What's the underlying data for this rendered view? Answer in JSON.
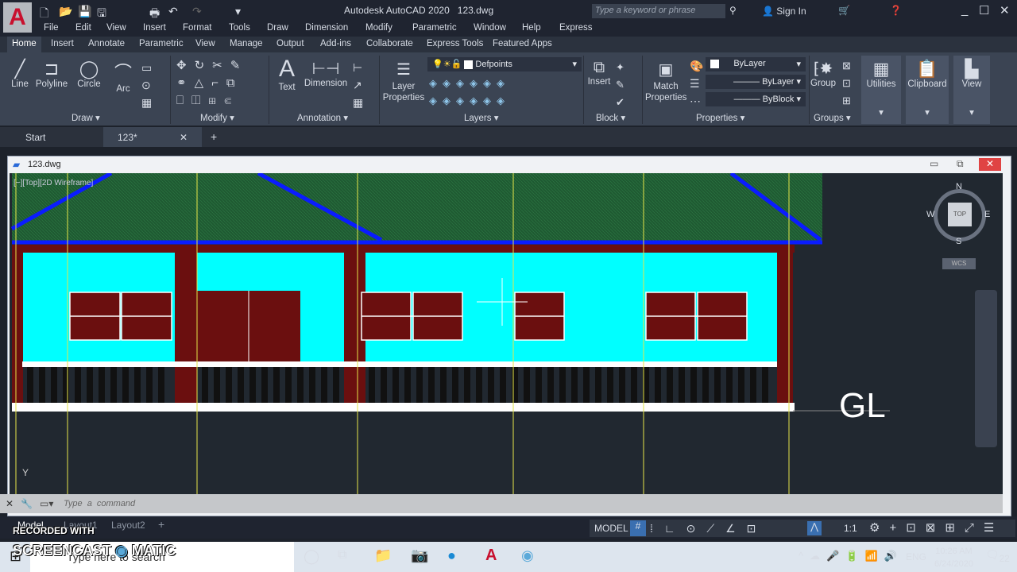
{
  "title": {
    "app": "Autodesk AutoCAD 2020",
    "file": "123.dwg",
    "search_placeholder": "Type a keyword or phrase",
    "sign_in": "Sign In",
    "logo": "A"
  },
  "menu": [
    "File",
    "Edit",
    "View",
    "Insert",
    "Format",
    "Tools",
    "Draw",
    "Dimension",
    "Modify",
    "Parametric",
    "Window",
    "Help",
    "Express"
  ],
  "ribbon_tabs": [
    "Home",
    "Insert",
    "Annotate",
    "Parametric",
    "View",
    "Manage",
    "Output",
    "Add-ins",
    "Collaborate",
    "Express Tools",
    "Featured Apps"
  ],
  "ribbon": {
    "draw": {
      "line": "Line",
      "polyline": "Polyline",
      "circle": "Circle",
      "arc": "Arc",
      "label": "Draw"
    },
    "modify": {
      "label": "Modify"
    },
    "annotation": {
      "text": "Text",
      "dimension": "Dimension",
      "label": "Annotation"
    },
    "layers": {
      "layer_properties_1": "Layer",
      "layer_properties_2": "Properties",
      "current_layer": "Defpoints",
      "label": "Layers"
    },
    "block": {
      "insert": "Insert",
      "label": "Block"
    },
    "properties": {
      "match_1": "Match",
      "match_2": "Properties",
      "color": "ByLayer",
      "linetype": "ByLayer",
      "lineweight": "ByBlock",
      "label": "Properties"
    },
    "groups": {
      "group": "Group",
      "label": "Groups"
    },
    "utilities": "Utilities",
    "clipboard": "Clipboard",
    "view": "View"
  },
  "file_tabs": {
    "start": "Start",
    "doc": "123*"
  },
  "drawing_window": {
    "title": "123.dwg",
    "viewport_label": "[−][Top][2D Wireframe]",
    "annotation_text": "GL",
    "ucs_y": "Y"
  },
  "viewcube": {
    "n": "N",
    "s": "S",
    "e": "E",
    "w": "W",
    "top": "TOP",
    "wcs": "WCS"
  },
  "command": {
    "placeholder": "Type a command"
  },
  "layout_tabs": [
    "Model",
    "Layout1",
    "Layout2",
    "+"
  ],
  "status": {
    "model": "MODEL",
    "scale": "1:1"
  },
  "taskbar": {
    "search_placeholder": "Type here to search",
    "lang": "ENG",
    "time": "10:26 AM",
    "date": "6/24/2020",
    "notifications": "22"
  },
  "watermark": {
    "line1": "RECORDED WITH",
    "line2": "SCREENCAST",
    "line3": "MATIC"
  },
  "colors": {
    "roof": "#1f5a32",
    "wall": "#00ffff",
    "trim": "#6b0f0f",
    "roof_line": "#0a1cff",
    "grid": "#e6e64a"
  }
}
